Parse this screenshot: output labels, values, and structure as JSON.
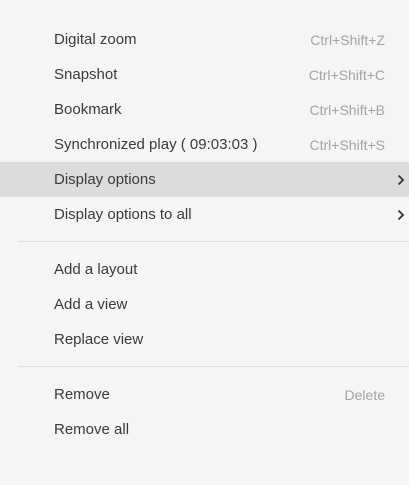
{
  "menu": {
    "items": [
      {
        "label": "Digital zoom",
        "shortcut": "Ctrl+Shift+Z"
      },
      {
        "label": "Snapshot",
        "shortcut": "Ctrl+Shift+C"
      },
      {
        "label": "Bookmark",
        "shortcut": "Ctrl+Shift+B"
      },
      {
        "label": "Synchronized play ( 09:03:03 )",
        "shortcut": "Ctrl+Shift+S"
      },
      {
        "label": "Display options",
        "submenu": true,
        "highlighted": true
      },
      {
        "label": "Display options to all",
        "submenu": true
      },
      {
        "label": "Add a layout"
      },
      {
        "label": "Add a view"
      },
      {
        "label": "Replace view"
      },
      {
        "label": "Remove",
        "shortcut": "Delete"
      },
      {
        "label": "Remove all"
      }
    ]
  }
}
